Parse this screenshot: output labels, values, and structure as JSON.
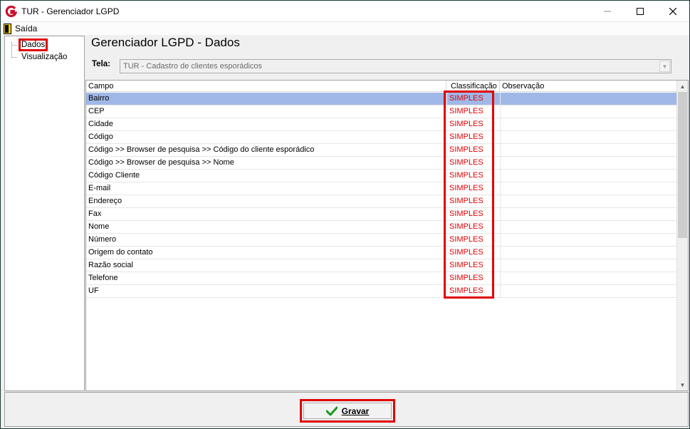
{
  "window": {
    "title": "TUR - Gerenciador LGPD"
  },
  "menu": {
    "exit_label": "Saída"
  },
  "tree": {
    "items": [
      {
        "label": "Dados"
      },
      {
        "label": "Visualização"
      }
    ]
  },
  "main": {
    "title": "Gerenciador LGPD - Dados",
    "tela_label": "Tela:",
    "tela_value": "TUR - Cadastro de clientes esporádicos"
  },
  "grid": {
    "columns": [
      "Campo",
      "Classificação",
      "Observação"
    ],
    "rows": [
      {
        "campo": "Bairro",
        "classificacao": "SIMPLES",
        "observacao": ""
      },
      {
        "campo": "CEP",
        "classificacao": "SIMPLES",
        "observacao": ""
      },
      {
        "campo": "Cidade",
        "classificacao": "SIMPLES",
        "observacao": ""
      },
      {
        "campo": "Código",
        "classificacao": "SIMPLES",
        "observacao": ""
      },
      {
        "campo": "Código >> Browser de pesquisa >> Código do cliente esporádico",
        "classificacao": "SIMPLES",
        "observacao": ""
      },
      {
        "campo": "Código >> Browser de pesquisa >> Nome",
        "classificacao": "SIMPLES",
        "observacao": ""
      },
      {
        "campo": "Código Cliente",
        "classificacao": "SIMPLES",
        "observacao": ""
      },
      {
        "campo": "E-mail",
        "classificacao": "SIMPLES",
        "observacao": ""
      },
      {
        "campo": "Endereço",
        "classificacao": "SIMPLES",
        "observacao": ""
      },
      {
        "campo": "Fax",
        "classificacao": "SIMPLES",
        "observacao": ""
      },
      {
        "campo": "Nome",
        "classificacao": "SIMPLES",
        "observacao": ""
      },
      {
        "campo": "Número",
        "classificacao": "SIMPLES",
        "observacao": ""
      },
      {
        "campo": "Origem do contato",
        "classificacao": "SIMPLES",
        "observacao": ""
      },
      {
        "campo": "Razão social",
        "classificacao": "SIMPLES",
        "observacao": ""
      },
      {
        "campo": "Telefone",
        "classificacao": "SIMPLES",
        "observacao": ""
      },
      {
        "campo": "UF",
        "classificacao": "SIMPLES",
        "observacao": ""
      }
    ]
  },
  "footer": {
    "save_label": "Gravar"
  },
  "colors": {
    "highlight": "#e00000",
    "selected_row": "#a0b8e8",
    "app_icon": "#c8102e"
  }
}
